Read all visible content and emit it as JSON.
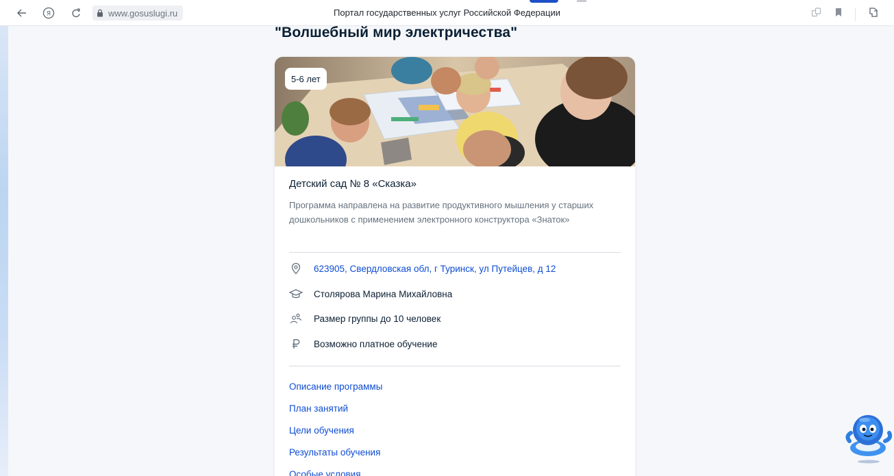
{
  "browser": {
    "url": "www.gosuslugi.ru",
    "page_title": "Портал государственных услуг Российской Федерации"
  },
  "program": {
    "title": "\"Волшебный мир электричества\"",
    "age_badge": "5-6 лет",
    "organization": "Детский сад № 8 «Сказка»",
    "description": "Программа направлена на развитие продуктивного мышления у старших дошкольников с применением электронного конструктора «Знаток»",
    "address": "623905, Свердловская обл, г Туринск, ул Путейцев, д 12",
    "teacher": "Столярова Марина Михайловна",
    "group_size": "Размер группы до 10 человек",
    "payment": "Возможно платное обучение",
    "links": [
      "Описание программы",
      "План занятий",
      "Цели обучения",
      "Результаты обучения",
      "Особые условия"
    ]
  },
  "icons": {
    "address": "location-pin-icon",
    "teacher": "graduation-cap-icon",
    "group": "people-icon",
    "payment": "ruble-icon"
  },
  "colors": {
    "link": "#0d4cd3",
    "text": "#0b1f33",
    "muted": "#66727f",
    "background": "#f5f7fb"
  }
}
